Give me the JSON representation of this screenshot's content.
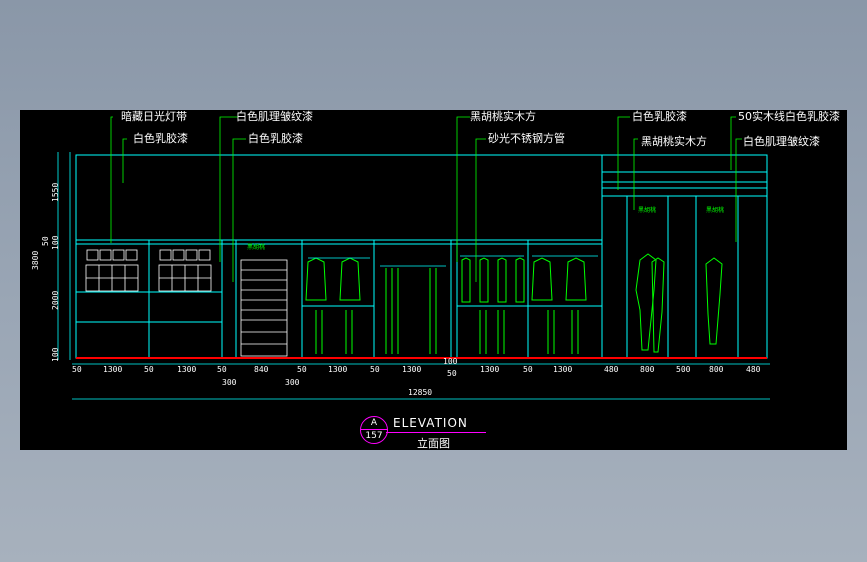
{
  "colors": {
    "background": "#000000",
    "outline": "#00ffff",
    "leader": "#00ff00",
    "floor": "#ff0000",
    "text": "#ffffff",
    "accent": "#ff00ff"
  },
  "labels": {
    "hidden_light": "暗藏日光灯带",
    "white_latex_1": "白色乳胶漆",
    "white_texture_1": "白色肌理皱纹漆",
    "white_latex_2": "白色乳胶漆",
    "black_walnut_1": "黑胡桃实木方",
    "stainless_tube": "砂光不锈钢方管",
    "white_latex_3": "白色乳胶漆",
    "black_walnut_2": "黑胡桃实木方",
    "wood_line": "50实木线白色乳胶漆",
    "white_texture_2": "白色肌理皱纹漆"
  },
  "dimensions": {
    "bottom_row": [
      "50",
      "1300",
      "50",
      "1300",
      "50",
      "840",
      "50",
      "1300",
      "50",
      "1300",
      "50",
      "1300",
      "50",
      "1300",
      "480",
      "800",
      "500",
      "800",
      "480"
    ],
    "extra_300_a": "300",
    "extra_300_b": "300",
    "extra_100": "100",
    "total": "12850",
    "vertical": [
      "1550",
      "50",
      "100",
      "2000",
      "100"
    ],
    "vertical_total": "3800"
  },
  "title": {
    "main": "ELEVATION",
    "sub": "立面图",
    "ref_top": "A",
    "ref_bottom": "157"
  },
  "cabinet_tags": [
    "黑胡桃",
    "黑胡桃",
    "黑胡桃"
  ]
}
